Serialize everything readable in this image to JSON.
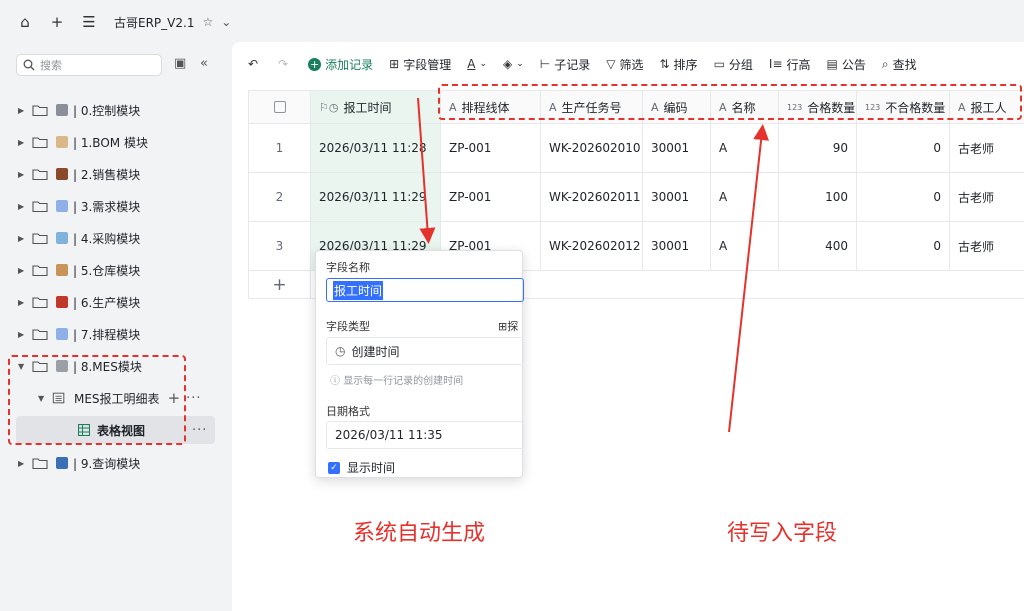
{
  "topbar": {
    "home_icon": "home-icon",
    "add_icon": "plus-icon",
    "menu_icon": "menu-icon",
    "app_title": "古哥ERP_V2.1",
    "star": "☆",
    "chevron": "⌄"
  },
  "sidebar": {
    "search_placeholder": "搜索",
    "items": [
      {
        "label": "| 0.控制模块",
        "emoji_color": "#8a8f99"
      },
      {
        "label": "| 1.BOM 模块",
        "emoji_color": "#c98b3a"
      },
      {
        "label": "| 2.销售模块",
        "emoji_color": "#8a4a2a"
      },
      {
        "label": "| 3.需求模块",
        "emoji_color": "#5b8bd6"
      },
      {
        "label": "| 4.采购模块",
        "emoji_color": "#4a8fc9"
      },
      {
        "label": "| 5.仓库模块",
        "emoji_color": "#b87a3e"
      },
      {
        "label": "| 6.生产模块",
        "emoji_color": "#c0392b"
      },
      {
        "label": "| 7.排程模块",
        "emoji_color": "#5b8bd6"
      },
      {
        "label": "| 8.MES模块",
        "emoji_color": "#7f8c8d"
      },
      {
        "label": "| 9.查询模块",
        "emoji_color": "#3a6fb5"
      }
    ],
    "child_table": "MES报工明细表",
    "view_label": "表格视图"
  },
  "toolbar": {
    "add_record": "添加记录",
    "field_manage": "字段管理",
    "sub_record": "子记录",
    "filter": "筛选",
    "sort": "排序",
    "group": "分组",
    "row_height": "行高",
    "notice": "公告",
    "find": "查找"
  },
  "table": {
    "headers": [
      "报工时间",
      "排程线体",
      "生产任务号",
      "编码",
      "名称",
      "合格数量",
      "不合格数量",
      "报工人"
    ],
    "rows": [
      {
        "no": "1",
        "time": "2026/03/11 11:28",
        "line": "ZP-001",
        "task": "WK-202602010",
        "code": "30001",
        "name": "A",
        "qualified": "90",
        "unqualified": "0",
        "reporter": "古老师"
      },
      {
        "no": "2",
        "time": "2026/03/11 11:29",
        "line": "ZP-001",
        "task": "WK-202602011",
        "code": "30001",
        "name": "A",
        "qualified": "100",
        "unqualified": "0",
        "reporter": "古老师"
      },
      {
        "no": "3",
        "time": "2026/03/11 11:29",
        "line": "ZP-001",
        "task": "WK-202602012",
        "code": "30001",
        "name": "A",
        "qualified": "400",
        "unqualified": "0",
        "reporter": "古老师"
      }
    ],
    "add_row": "+"
  },
  "popup": {
    "field_name_label": "字段名称",
    "field_name_value": "报工时间",
    "field_type_label": "字段类型",
    "explore": "探",
    "field_type_value": "创建时间",
    "hint": "显示每一行记录的创建时间",
    "date_format_label": "日期格式",
    "date_format_value": "2026/03/11 11:35",
    "show_time": "显示时间"
  },
  "annotations": {
    "left_caption": "系统自动生成",
    "right_caption": "待写入字段",
    "color": "#e5322d"
  }
}
